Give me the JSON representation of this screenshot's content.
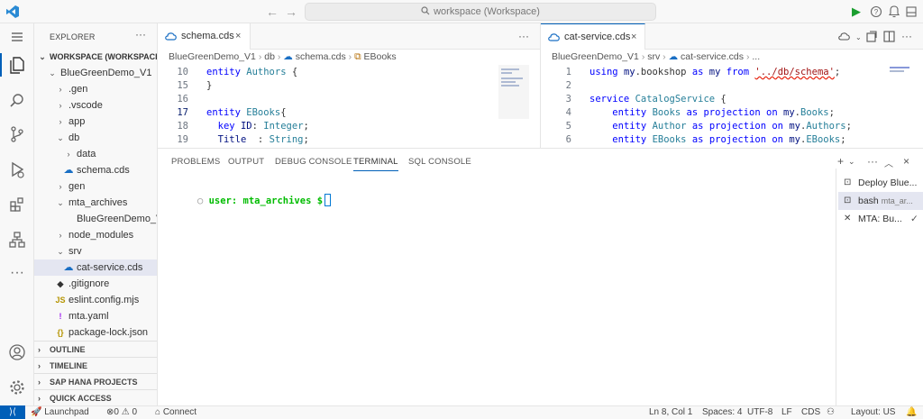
{
  "titlebar": {
    "search_text": "workspace (Workspace)",
    "back_arrow": "←",
    "forward_arrow": "→"
  },
  "explorer": {
    "title": "EXPLORER",
    "more": "···",
    "workspace_label": "WORKSPACE (WORKSPACE)",
    "items": [
      {
        "label": "BlueGreenDemo_V1",
        "icon": "chevron-down",
        "glyph": ""
      },
      {
        "label": ".gen",
        "icon": "chevron-right",
        "glyph": ""
      },
      {
        "label": ".vscode",
        "icon": "chevron-right",
        "glyph": ""
      },
      {
        "label": "app",
        "icon": "chevron-right",
        "glyph": ""
      },
      {
        "label": "db",
        "icon": "chevron-down",
        "glyph": ""
      },
      {
        "label": "data",
        "icon": "chevron-right",
        "glyph": ""
      },
      {
        "label": "schema.cds",
        "icon": "cds-file",
        "glyph": ""
      },
      {
        "label": "gen",
        "icon": "chevron-right",
        "glyph": ""
      },
      {
        "label": "mta_archives",
        "icon": "chevron-down",
        "glyph": ""
      },
      {
        "label": "BlueGreenDemo_V...",
        "icon": "file",
        "glyph": ""
      },
      {
        "label": "node_modules",
        "icon": "chevron-right",
        "glyph": ""
      },
      {
        "label": "srv",
        "icon": "chevron-down",
        "glyph": ""
      },
      {
        "label": "cat-service.cds",
        "icon": "cds-file",
        "glyph": ""
      },
      {
        "label": ".gitignore",
        "icon": "git-file",
        "glyph": "◆"
      },
      {
        "label": "eslint.config.mjs",
        "icon": "js-file",
        "glyph": "JS"
      },
      {
        "label": "mta.yaml",
        "icon": "yaml-file",
        "glyph": "!"
      },
      {
        "label": "package-lock.json",
        "icon": "json-file",
        "glyph": "{}"
      }
    ],
    "sections": [
      "OUTLINE",
      "TIMELINE",
      "SAP HANA PROJECTS",
      "QUICK ACCESS"
    ]
  },
  "editor_left": {
    "tab_label": "schema.cds",
    "tab_close": "×",
    "more": "···",
    "breadcrumb": [
      "BlueGreenDemo_V1",
      "db",
      "schema.cds",
      "EBooks"
    ],
    "lines": [
      {
        "num": "10",
        "code": "entity Authors {"
      },
      {
        "num": "15",
        "code": "}"
      },
      {
        "num": "16",
        "code": ""
      },
      {
        "num": "17",
        "code": "entity EBooks{"
      },
      {
        "num": "18",
        "code": "  key ID: Integer;"
      },
      {
        "num": "19",
        "code": "  Title  : String;"
      }
    ]
  },
  "editor_right": {
    "tab_label": "cat-service.cds",
    "tab_close": "×",
    "breadcrumb": [
      "BlueGreenDemo_V1",
      "srv",
      "cat-service.cds",
      "..."
    ],
    "lines": [
      {
        "num": "1",
        "code": "using my.bookshop as my from '../db/schema';"
      },
      {
        "num": "2",
        "code": ""
      },
      {
        "num": "3",
        "code": "service CatalogService {"
      },
      {
        "num": "4",
        "code": "    entity Books as projection on my.Books;"
      },
      {
        "num": "5",
        "code": "    entity Author as projection on my.Authors;"
      },
      {
        "num": "6",
        "code": "    entity EBooks as projection on my.EBooks;"
      }
    ]
  },
  "panel": {
    "tabs": [
      "PROBLEMS",
      "OUTPUT",
      "DEBUG CONSOLE",
      "TERMINAL",
      "SQL CONSOLE"
    ],
    "active_tab": "TERMINAL",
    "prompt_user": "user:",
    "prompt_cwd": "mta_archives $",
    "terminals": [
      {
        "label": "Deploy Blue...",
        "sub": "",
        "icon": "terminal-icon"
      },
      {
        "label": "bash",
        "sub": "mta_ar...",
        "icon": "terminal-icon"
      },
      {
        "label": "MTA: Bu...",
        "sub": "",
        "icon": "tools-icon"
      }
    ]
  },
  "statusbar": {
    "launchpad": "Launchpad",
    "errors": "0",
    "warnings": "0",
    "connect": "Connect",
    "position": "Ln 8, Col 1",
    "spaces": "Spaces: 4",
    "encoding": "UTF-8",
    "eol": "LF",
    "language": "CDS",
    "layout": "Layout: US"
  },
  "colors": {
    "accent": "#005fb8",
    "keyword": "#0000ff",
    "type": "#267f99",
    "string": "#a31515",
    "terminal_green": "#00bc00",
    "run_green": "#1a9e2f"
  }
}
